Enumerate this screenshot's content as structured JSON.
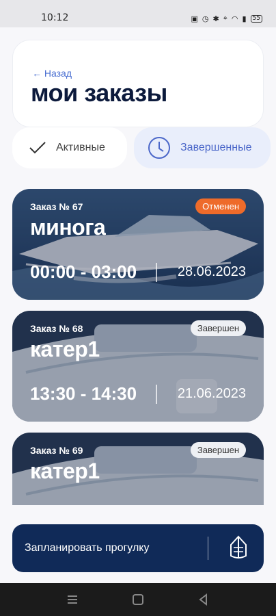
{
  "status_bar": {
    "time": "10:12",
    "battery": "55"
  },
  "header": {
    "back_label": "← Назад",
    "title": "мои заказы"
  },
  "tabs": [
    {
      "label": "Активные",
      "icon": "check-icon"
    },
    {
      "label": "Завершенные",
      "icon": "clock-icon"
    }
  ],
  "orders": [
    {
      "number": "Заказ № 67",
      "name": "минога",
      "time": "00:00 - 03:00",
      "date": "28.06.2023",
      "status": "Отменен"
    },
    {
      "number": "Заказ № 68",
      "name": "катер1",
      "time": "13:30 - 14:30",
      "date": "21.06.2023",
      "status": "Завершен"
    },
    {
      "number": "Заказ № 69",
      "name": "катер1",
      "status": "Завершен"
    }
  ],
  "cta": {
    "label": "Запланировать прогулку",
    "icon": "boat-icon"
  },
  "colors": {
    "accent": "#4b67c9",
    "navy": "#102a58",
    "cancel": "#ee6b2a"
  }
}
